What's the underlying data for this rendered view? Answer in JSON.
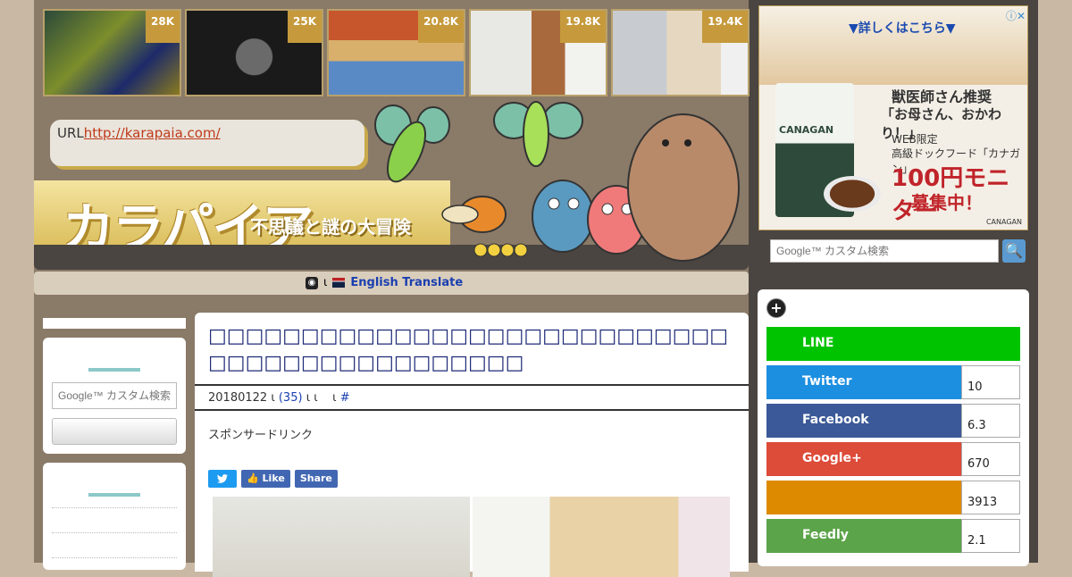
{
  "thumbnails": [
    {
      "count": "28K"
    },
    {
      "count": "25K"
    },
    {
      "count": "20.8K"
    },
    {
      "count": "19.8K"
    },
    {
      "count": "19.4K"
    }
  ],
  "header": {
    "url_label": "URL",
    "url_link": "http://karapaia.com/",
    "logo": "カラパイア",
    "tagline": "不思議と謎の大冒険"
  },
  "translate": {
    "separator": "ι",
    "label": "English Translate"
  },
  "sidebar": {
    "search_placeholder": "Google™ カスタム検索"
  },
  "article": {
    "title": "□□□□□□□□□□□□□□□□□□□□□□□□□□□□□□□□□□□□□□□□□□□□□",
    "date": "20180122",
    "meta_sep1": "ι",
    "comments": "(35)",
    "meta_sep2": "ι ι",
    "meta_sep3": "ι",
    "hash": "#",
    "sponsor": "スポンサードリンク",
    "fb_like": "Like",
    "fb_share": "Share"
  },
  "ad": {
    "top_link": "▼詳しくはこちら▼",
    "brand": "CANAGAN",
    "line1": "獣医師さん推奨",
    "line2": "「お母さん、おかわり！」",
    "line3": "WEB限定",
    "line4": "高級ドックフード「カナガン」",
    "line5": "100円モニター",
    "line6": "募集中！",
    "logo_small": "CANAGAN"
  },
  "right": {
    "search_placeholder": "Google™ カスタム検索"
  },
  "share": [
    {
      "name": "LINE",
      "count": "",
      "color": "#00c300"
    },
    {
      "name": "Twitter",
      "count": "10",
      "color": "#1d8fe0"
    },
    {
      "name": "Facebook",
      "count": "6.3",
      "color": "#3b5998"
    },
    {
      "name": "Google+",
      "count": "670",
      "color": "#dd4b39"
    },
    {
      "name": "",
      "count": "3913",
      "color": "#de8a00"
    },
    {
      "name": "Feedly",
      "count": "2.1",
      "color": "#5ca44a"
    }
  ]
}
